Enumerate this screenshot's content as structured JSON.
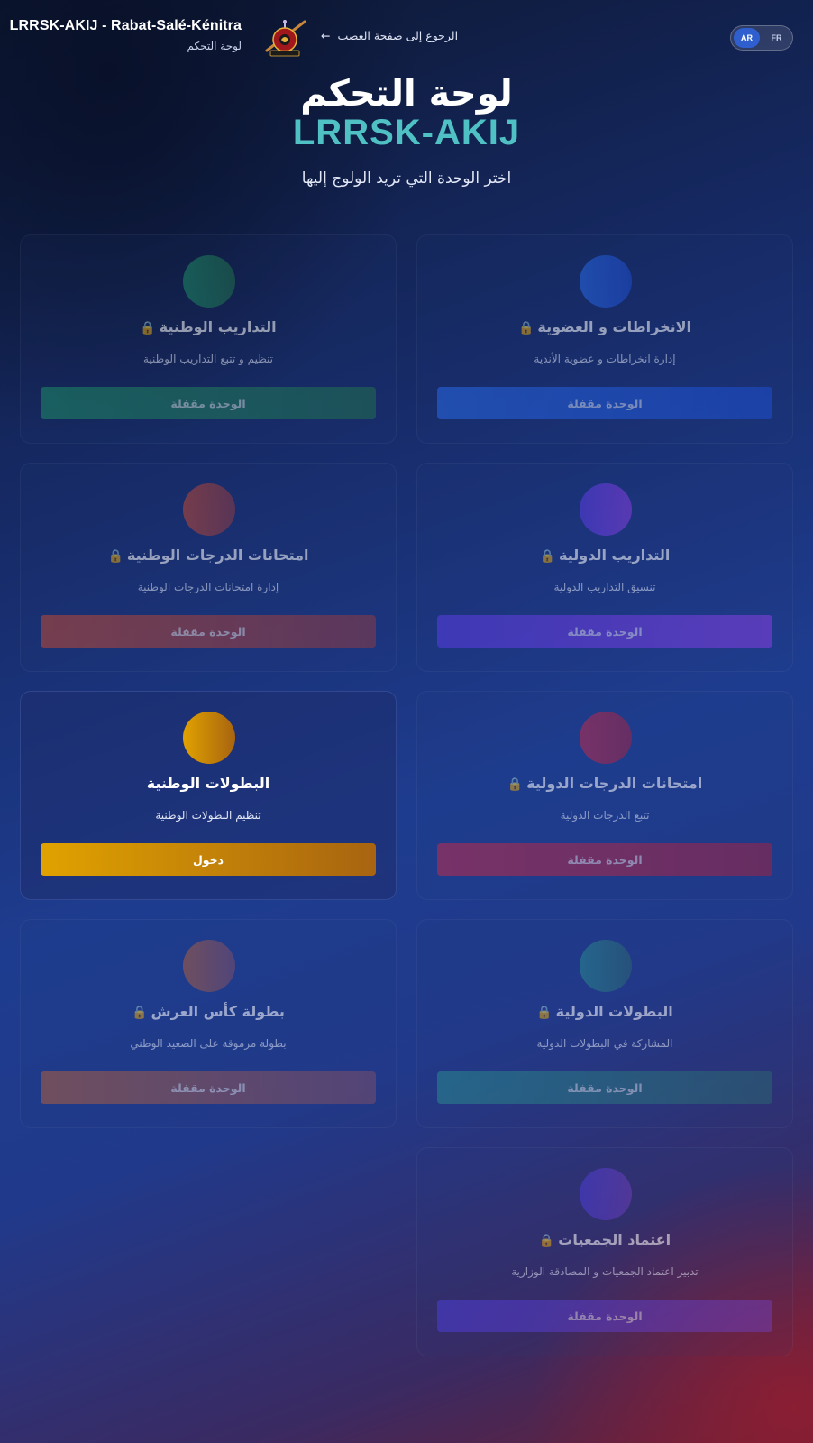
{
  "header": {
    "brand_name": "LRRSK-AKIJ - Rabat-Salé-Kénitra",
    "brand_sub": "لوحة التحكم",
    "back_arrow": "←",
    "back_label": "الرجوع إلى صفحة العصب",
    "lang": [
      {
        "label": "AR",
        "active": true
      },
      {
        "label": "FR",
        "active": false
      }
    ]
  },
  "hero": {
    "title": "لوحة التحكم",
    "brand": "LRRSK-AKIJ",
    "subtitle": "اختر الوحدة التي تريد الولوج إليها"
  },
  "lock_icon": "🔒",
  "modules": [
    {
      "title": "الانخراطات و العضوية",
      "desc": "إدارة انخراطات و عضوية الأندية",
      "button": "الوحدة مقفلة",
      "locked": true,
      "colors": [
        "#2a6be8",
        "#1f4fd0"
      ]
    },
    {
      "title": "التداريب الوطنية",
      "desc": "تنظيم و تتبع التداريب الوطنية",
      "button": "الوحدة مقفلة",
      "locked": true,
      "colors": [
        "#1f8f6a",
        "#23704f"
      ]
    },
    {
      "title": "التداريب الدولية",
      "desc": "تنسيق التداريب الدولية",
      "button": "الوحدة مقفلة",
      "locked": true,
      "colors": [
        "#5b3de3",
        "#8a3fe0"
      ]
    },
    {
      "title": "امتحانات الدرجات الوطنية",
      "desc": "إدارة امتحانات الدرجات الوطنية",
      "button": "الوحدة مقفلة",
      "locked": true,
      "colors": [
        "#c24b33",
        "#8e3b45"
      ]
    },
    {
      "title": "امتحانات الدرجات الدولية",
      "desc": "تتبع الدرجات الدولية",
      "button": "الوحدة مقفلة",
      "locked": true,
      "colors": [
        "#c02c4a",
        "#a02442"
      ]
    },
    {
      "title": "البطولات الوطنية",
      "desc": "تنظيم البطولات الوطنية",
      "button": "دخول",
      "locked": false,
      "colors": [
        "#e0a200",
        "#a86410"
      ]
    },
    {
      "title": "البطولات الدولية",
      "desc": "المشاركة في البطولات الدولية",
      "button": "الوحدة مقفلة",
      "locked": true,
      "colors": [
        "#2a8a8e",
        "#2b6570"
      ]
    },
    {
      "title": "بطولة كأس العرش",
      "desc": "بطولة مرموقة على الصعيد الوطني",
      "button": "الوحدة مقفلة",
      "locked": true,
      "colors": [
        "#b0603a",
        "#7a4e6a"
      ]
    },
    {
      "title": "اعتماد الجمعيات",
      "desc": "تدبير اعتماد الجمعيات و المصادقة الوزارية",
      "button": "الوحدة مقفلة",
      "locked": true,
      "colors": [
        "#4b3ed8",
        "#6b3fb8"
      ]
    }
  ]
}
